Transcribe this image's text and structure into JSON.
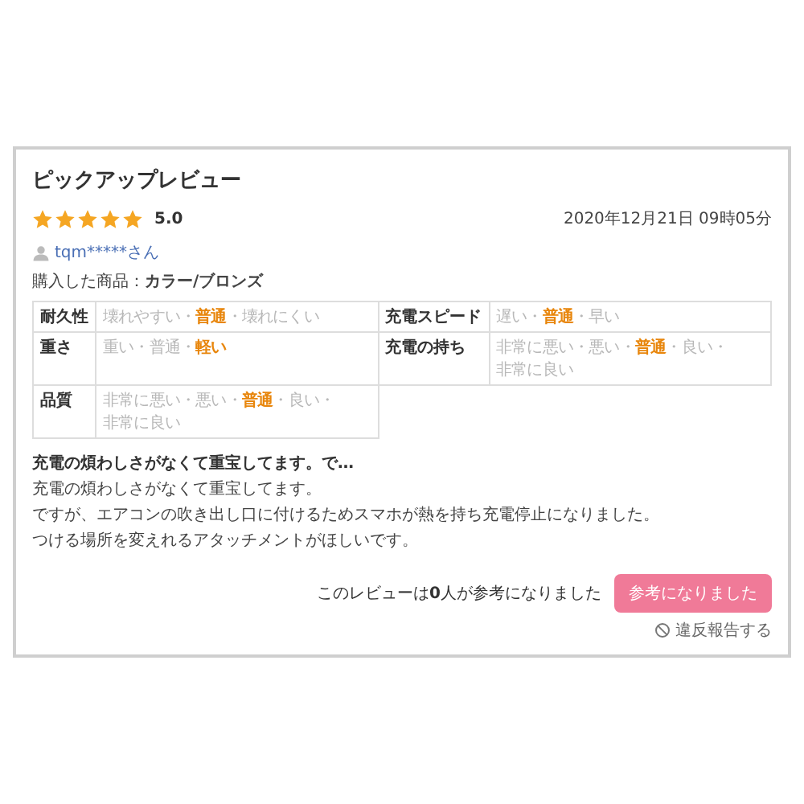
{
  "review": {
    "heading": "ピックアップレビュー",
    "stars": 5,
    "score": "5.0",
    "date": "2020年12月21日 09時05分",
    "reviewer": "tqm*****さん",
    "purchased": "購入した商品：**カラー/ブロンズ**",
    "ratings": [
      {
        "label": "耐久性",
        "options": [
          {
            "text": "壊れやすい",
            "selected": false
          },
          {
            "text": "普通",
            "selected": true
          },
          {
            "text": "壊れにくい",
            "selected": false
          }
        ]
      },
      {
        "label": "充電スピード",
        "options": [
          {
            "text": "遅い",
            "selected": false
          },
          {
            "text": "普通",
            "selected": true
          },
          {
            "text": "早い",
            "selected": false
          }
        ]
      },
      {
        "label": "重さ",
        "options": [
          {
            "text": "重い",
            "selected": false
          },
          {
            "text": "普通",
            "selected": false
          },
          {
            "text": "軽い",
            "selected": true
          }
        ]
      },
      {
        "label": "充電の持ち",
        "options": [
          {
            "text": "非常に悪い",
            "selected": false
          },
          {
            "text": "悪い",
            "selected": false
          },
          {
            "text": "普通",
            "selected": true
          },
          {
            "text": "良い",
            "selected": false
          },
          {
            "text": "非常に良い",
            "selected": false
          }
        ]
      },
      {
        "label": "品質",
        "options": [
          {
            "text": "非常に悪い",
            "selected": false
          },
          {
            "text": "悪い",
            "selected": false
          },
          {
            "text": "普通",
            "selected": true
          },
          {
            "text": "良い",
            "selected": false
          },
          {
            "text": "非常に良い",
            "selected": false
          }
        ]
      }
    ],
    "separator": "・",
    "title": "充電の煩わしさがなくて重宝してます。で…",
    "body": [
      "充電の煩わしさがなくて重宝してます。",
      "ですが、エアコンの吹き出し口に付けるためスマホが熱を持ち充電停止になりました。",
      "つける場所を変えれるアタッチメントがほしいです。"
    ],
    "helpful_text": "このレビューは**0**人が参考になりました",
    "helpful_button": "参考になりました",
    "report": "違反報告する"
  }
}
